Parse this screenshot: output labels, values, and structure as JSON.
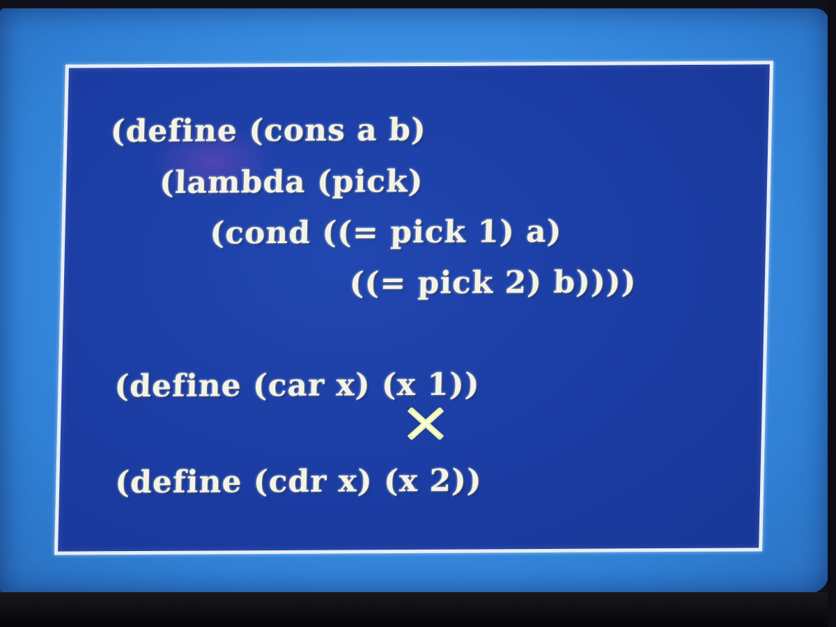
{
  "code": {
    "line1": "(define (cons a b)",
    "line2": "(lambda (pick)",
    "line3": "(cond ((= pick 1) a)",
    "line4": "((= pick 2) b))))",
    "line5": "(define (car x) (x 1))",
    "line6": "(define (cdr x) (x 2))"
  },
  "cursor": {
    "icon": "x-cursor-icon",
    "color": "#e9f2a8"
  },
  "colors": {
    "panel": "#1b3ca3",
    "screen": "#3b8fe3",
    "text": "#f4f4e6"
  }
}
